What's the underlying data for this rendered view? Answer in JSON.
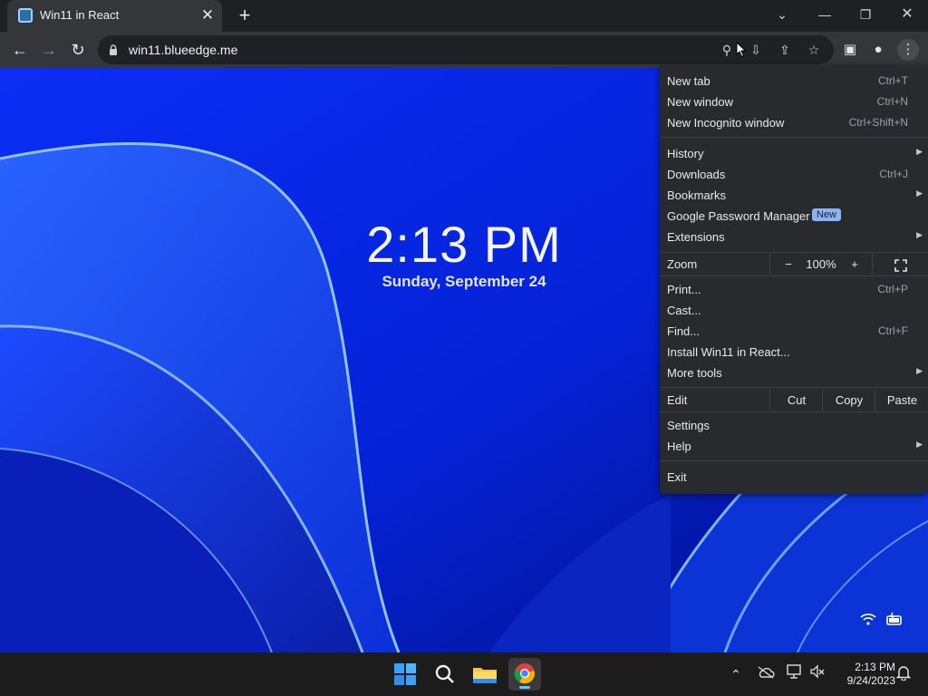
{
  "browser": {
    "tab": {
      "title": "Win11 in React",
      "close_icon": "close-icon"
    },
    "new_tab_icon": "plus-icon",
    "window_controls": [
      "chevron-down-icon",
      "minimize-icon",
      "restore-icon",
      "close-icon"
    ],
    "url": "win11.blueedge.me"
  },
  "lockscreen": {
    "time": "2:13 PM",
    "date": "Sunday, September 24"
  },
  "menu": {
    "items": [
      {
        "label": "New tab",
        "shortcut": "Ctrl+T"
      },
      {
        "label": "New window",
        "shortcut": "Ctrl+N"
      },
      {
        "label": "New Incognito window",
        "shortcut": "Ctrl+Shift+N"
      },
      {
        "label": "History",
        "submenu": true
      },
      {
        "label": "Downloads",
        "shortcut": "Ctrl+J"
      },
      {
        "label": "Bookmarks",
        "submenu": true
      },
      {
        "label": "Google Password Manager",
        "badge": "New"
      },
      {
        "label": "Extensions",
        "submenu": true
      },
      {
        "label": "Print...",
        "shortcut": "Ctrl+P"
      },
      {
        "label": "Cast..."
      },
      {
        "label": "Find...",
        "shortcut": "Ctrl+F"
      },
      {
        "label": "Install Win11 in React..."
      },
      {
        "label": "More tools",
        "submenu": true
      },
      {
        "label": "Settings"
      },
      {
        "label": "Help",
        "submenu": true
      },
      {
        "label": "Exit"
      }
    ],
    "zoom": {
      "label": "Zoom",
      "minus": "−",
      "value": "100%",
      "plus": "+"
    },
    "edit": {
      "label": "Edit",
      "cut": "Cut",
      "copy": "Copy",
      "paste": "Paste"
    }
  },
  "taskbar": {
    "apps": [
      "windows-start-icon",
      "search-icon",
      "file-explorer-icon",
      "chrome-icon"
    ],
    "time": "2:13 PM",
    "date": "9/24/2023"
  },
  "colors": {
    "accent_blue": "#8ab4f8",
    "wallpaper_blue": "#0625e8",
    "menu_bg": "#292a2d"
  }
}
